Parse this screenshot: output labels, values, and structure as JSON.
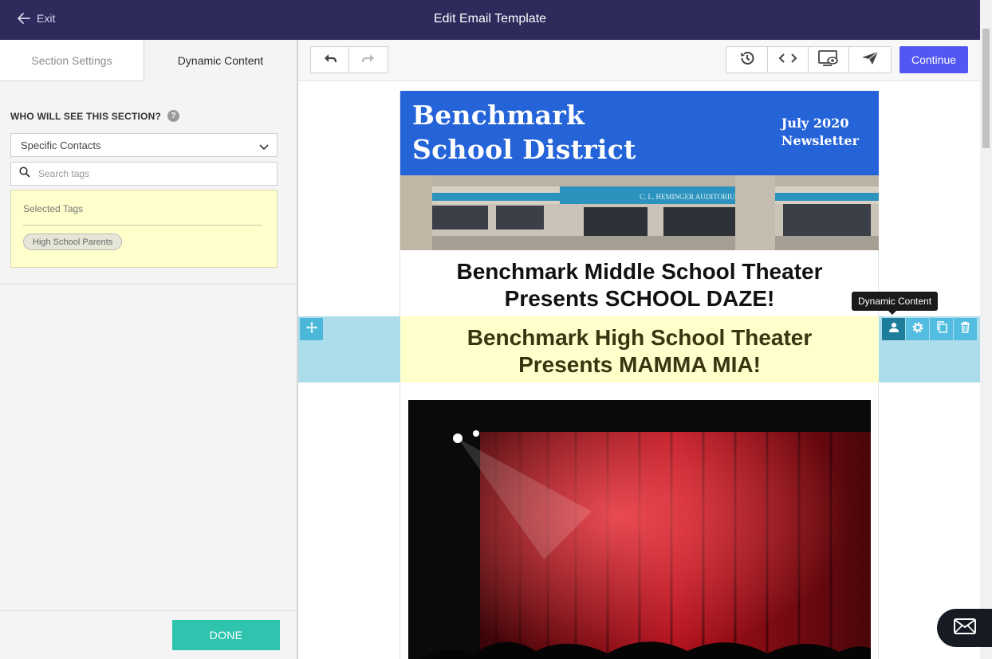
{
  "topbar": {
    "exit_label": "Exit",
    "title": "Edit Email Template"
  },
  "left_panel": {
    "tabs": [
      {
        "label": "Section Settings",
        "active": false
      },
      {
        "label": "Dynamic Content",
        "active": true
      }
    ],
    "who_label": "WHO WILL SEE THIS SECTION?",
    "help_icon": "?",
    "audience_select": {
      "value": "Specific Contacts"
    },
    "search": {
      "placeholder": "Search tags"
    },
    "selected_tags": {
      "label": "Selected Tags",
      "tags": [
        "High School Parents"
      ]
    },
    "done_label": "DONE"
  },
  "toolbar": {
    "undo_icon": "undo-icon",
    "redo_icon": "redo-icon",
    "history_icon": "history-icon",
    "code_icon": "code-icon",
    "preview_icon": "preview-icon",
    "send_icon": "send-icon",
    "continue_label": "Continue"
  },
  "email": {
    "district_line1": "Benchmark",
    "district_line2": "School District",
    "date_line1": "July 2020",
    "date_line2": "Newsletter",
    "ms_line1": "Benchmark Middle School Theater",
    "ms_line2": "Presents SCHOOL DAZE!",
    "hs_line1": "Benchmark High School Theater",
    "hs_line2": "Presents MAMMA MIA!",
    "building_sign": "C. L. HEMINGER AUDITORIUM"
  },
  "section_tools": {
    "tooltip": "Dynamic Content"
  },
  "colors": {
    "topbar": "#2e2a5c",
    "header_blue": "#2563d8",
    "continue": "#5157f0",
    "done": "#2ec4ad",
    "dynamic_highlight": "#ffffcc",
    "row_highlight": "#addceb"
  }
}
